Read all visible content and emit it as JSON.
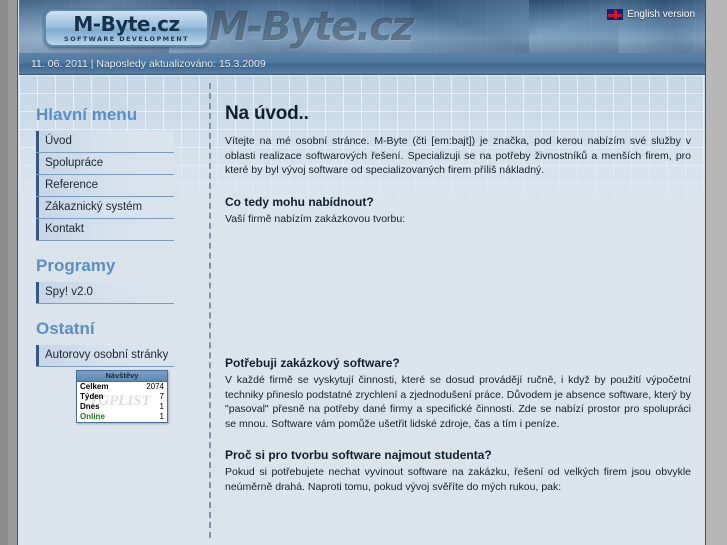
{
  "header": {
    "logo_text": "M-Byte.cz",
    "logo_subtitle": "SOFTWARE DEVELOPMENT",
    "banner_watermark": "M-Byte.cz",
    "lang_link_label": "English version",
    "flag_icon": "uk-flag-icon"
  },
  "datebar": {
    "text": "11. 06. 2011 | Naposledy aktualizováno: 15.3.2009"
  },
  "sidebar": {
    "main_menu_heading": "Hlavní menu",
    "main_menu_items": [
      {
        "label": "Úvod"
      },
      {
        "label": "Spolupráce"
      },
      {
        "label": "Reference"
      },
      {
        "label": "Zákaznický systém"
      },
      {
        "label": "Kontakt"
      }
    ],
    "programy_heading": "Programy",
    "programy_items": [
      {
        "label": "Spy! v2.0"
      }
    ],
    "ostatni_heading": "Ostatní",
    "ostatni_items": [
      {
        "label": "Autorovy osobní stránky"
      }
    ]
  },
  "counter": {
    "title": "Návštěvy",
    "watermark": "TGPLIST",
    "rows": [
      {
        "label": "Celkem",
        "value": "2074"
      },
      {
        "label": "Týden",
        "value": "7"
      },
      {
        "label": "Dnes",
        "value": "1"
      },
      {
        "label": "Online",
        "value": "1"
      }
    ]
  },
  "main": {
    "title": "Na úvod..",
    "intro": "Vítejte na mé osobní stránce. M-Byte (čti [em:bajt]) je značka, pod kerou nabízím své služby v oblasti realizace softwarových řešení. Specializuji se na potřeby živnostníků a menších firem, pro které by byl vývoj software od specializovaných firem příliš nákladný.",
    "section_offer_heading": "Co tedy mohu nabídnout?",
    "section_offer_body": "Vaší firmě nabízím zakázkovou tvorbu:",
    "section_need_heading": "Potřebuji zakázkový software?",
    "section_need_body": "V každé firmě se vyskytují činnosti, které se dosud provádějí ručně, i když by použití výpočetní techniky přineslo podstatné zrychlení a zjednodušení práce. Důvodem je absence software, který by \"pasoval\" přesně na potřeby dané firmy a specifické činnosti. Zde se nabízí prostor pro spolupráci se mnou. Software vám pomůže ušetřit lidské zdroje, čas a tím i peníze.",
    "section_student_heading": "Proč si pro tvorbu software najmout studenta?",
    "section_student_body": "Pokud si potřebujete nechat vyvinout software na zakázku, řešení od velkých firem jsou obvykle neúměrně drahá. Naproti tomu, pokud vývoj svěříte do mých rukou, pak:"
  },
  "colors": {
    "accent_blue": "#5b8fc4",
    "menu_bar": "#35567f",
    "content_bg": "#dbe4ed",
    "datebar": "#4f77a0",
    "frame_gray": "#8e8e8e"
  }
}
